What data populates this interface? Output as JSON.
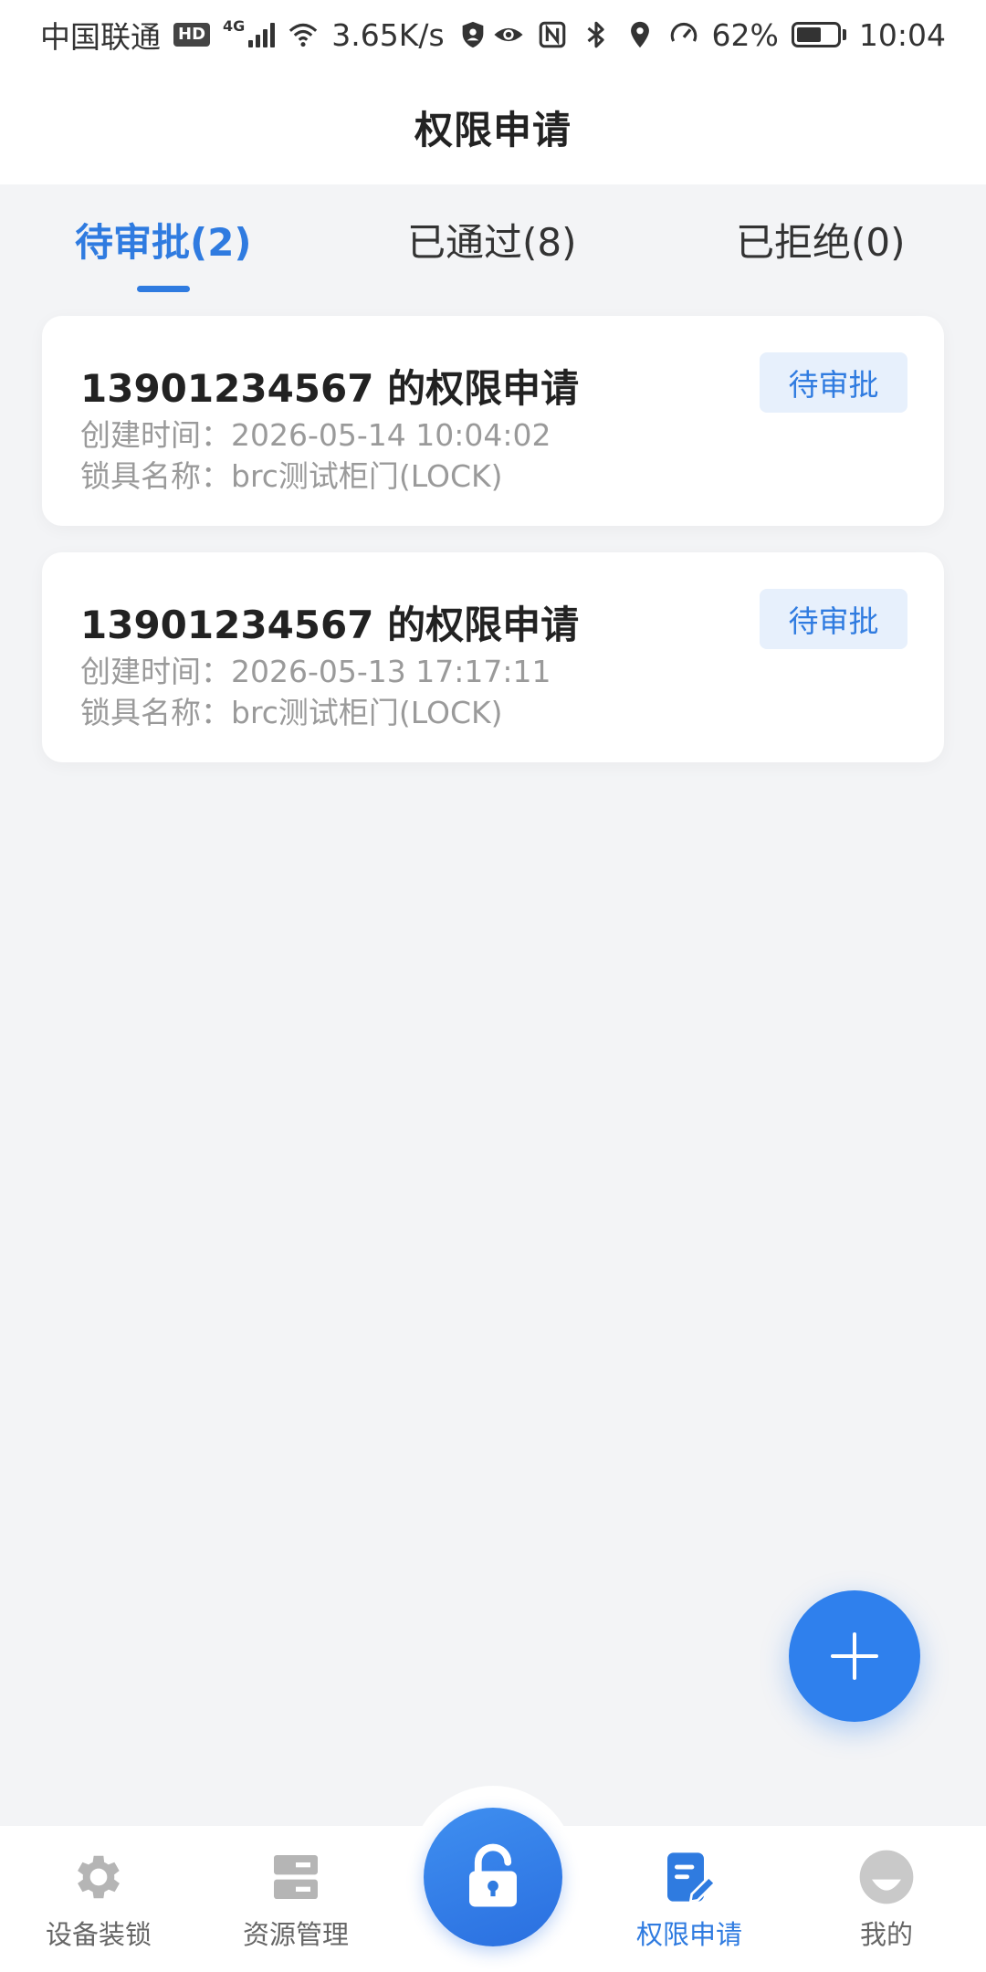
{
  "status_bar": {
    "carrier": "中国联通",
    "hd": "HD",
    "network": "4G",
    "speed": "3.65K/s",
    "battery": "62%",
    "battery_level": 0.62,
    "time": "10:04"
  },
  "header": {
    "title": "权限申请"
  },
  "tabs": [
    {
      "label": "待审批(2)",
      "active": true
    },
    {
      "label": "已通过(8)",
      "active": false
    },
    {
      "label": "已拒绝(0)",
      "active": false
    }
  ],
  "requests": [
    {
      "title": "13901234567 的权限申请",
      "created": "创建时间：2026-05-14 10:04:02",
      "lock": "锁具名称：brc测试柜门(LOCK)",
      "status": "待审批"
    },
    {
      "title": "13901234567 的权限申请",
      "created": "创建时间：2026-05-13 17:17:11",
      "lock": "锁具名称：brc测试柜门(LOCK)",
      "status": "待审批"
    }
  ],
  "fab": {
    "icon": "plus-icon"
  },
  "bottom_nav": [
    {
      "label": "设备装锁",
      "icon": "gear-icon",
      "active": false
    },
    {
      "label": "资源管理",
      "icon": "server-icon",
      "active": false
    },
    {
      "label": "",
      "icon": "unlock-icon",
      "active": false
    },
    {
      "label": "权限申请",
      "icon": "edit-document-icon",
      "active": true
    },
    {
      "label": "我的",
      "icon": "avatar-icon",
      "active": false
    }
  ],
  "colors": {
    "accent": "#2f7be0",
    "tag_bg": "#e7f0fc",
    "page_bg": "#f3f4f6",
    "muted_text": "#9a9a9a"
  }
}
